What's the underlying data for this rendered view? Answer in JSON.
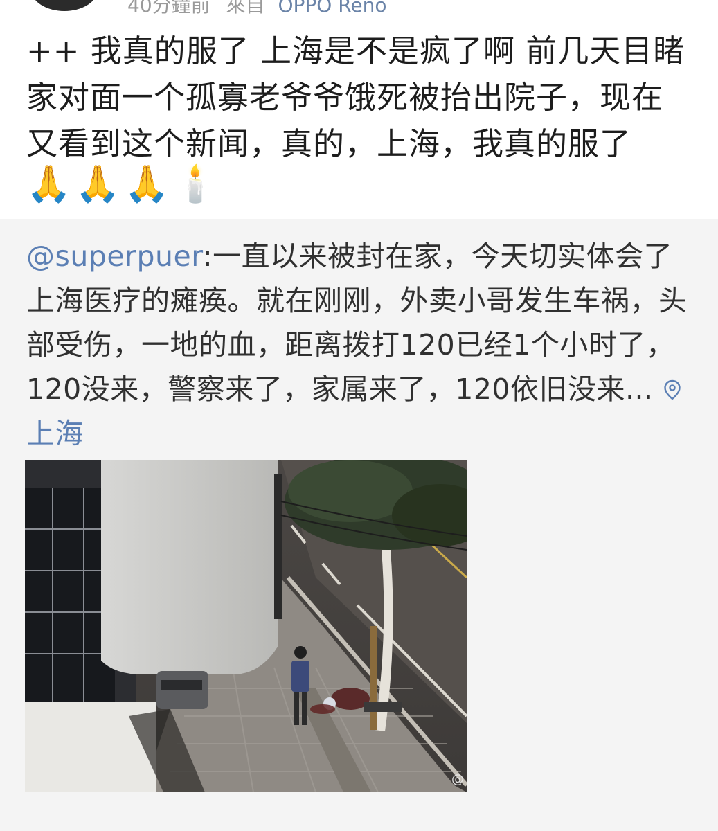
{
  "header": {
    "time_text": "40分鐘前",
    "from_text": "來自",
    "device_text": "OPPO Reno"
  },
  "post": {
    "text": "++ 我真的服了 上海是不是疯了啊 前几天目睹家对面一个孤寡老爷爷饿死被抬出院子，现在又看到这个新闻，真的，上海，我真的服了",
    "emojis": [
      "🙏",
      "🙏",
      "🙏",
      "🕯️"
    ],
    "emoji_icons": [
      "folded-hands-icon",
      "folded-hands-icon",
      "folded-hands-icon",
      "candle-icon"
    ]
  },
  "repost": {
    "mention": "@superpuer",
    "text": ":一直以来被封在家，今天切实体会了上海医疗的瘫痪。就在刚刚，外卖小哥发生车祸，头部受伤，一地的血，距离拨打120已经1个小时了，120没来，警察来了，家属来了，120依旧没来...",
    "location": "上海",
    "image_watermark": "@"
  },
  "colors": {
    "link": "#5b7fb4",
    "repost_bg": "#f4f4f4",
    "text": "#1d1d1d"
  }
}
